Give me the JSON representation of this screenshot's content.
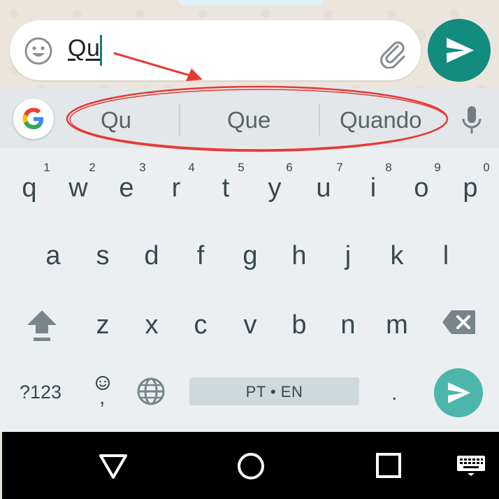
{
  "chat": {
    "input_text": "Qu"
  },
  "suggestions": [
    "Qu",
    "Que",
    "Quando"
  ],
  "keyboard": {
    "row1": [
      {
        "key": "q",
        "num": "1"
      },
      {
        "key": "w",
        "num": "2"
      },
      {
        "key": "e",
        "num": "3"
      },
      {
        "key": "r",
        "num": "4"
      },
      {
        "key": "t",
        "num": "5"
      },
      {
        "key": "y",
        "num": "6"
      },
      {
        "key": "u",
        "num": "7"
      },
      {
        "key": "i",
        "num": "8"
      },
      {
        "key": "o",
        "num": "9"
      },
      {
        "key": "p",
        "num": "0"
      }
    ],
    "row2": [
      "a",
      "s",
      "d",
      "f",
      "g",
      "h",
      "j",
      "k",
      "l"
    ],
    "row3": [
      "z",
      "x",
      "c",
      "v",
      "b",
      "n",
      "m"
    ],
    "symbols_label": "?123",
    "emoji_comma": ",",
    "space_label": "PT • EN",
    "period": "."
  },
  "colors": {
    "accent": "#128c7e",
    "keyboard_send": "#4db6ac",
    "annotation": "#e53935"
  },
  "icons": {
    "emoji": "emoji-icon",
    "attach": "paperclip-icon",
    "send": "send-icon",
    "google": "google-icon",
    "mic": "mic-icon",
    "shift": "shift-icon",
    "backspace": "backspace-icon",
    "globe": "globe-icon",
    "back": "nav-back-icon",
    "home": "nav-home-icon",
    "recents": "nav-recents-icon",
    "keyboard": "keyboard-icon"
  }
}
